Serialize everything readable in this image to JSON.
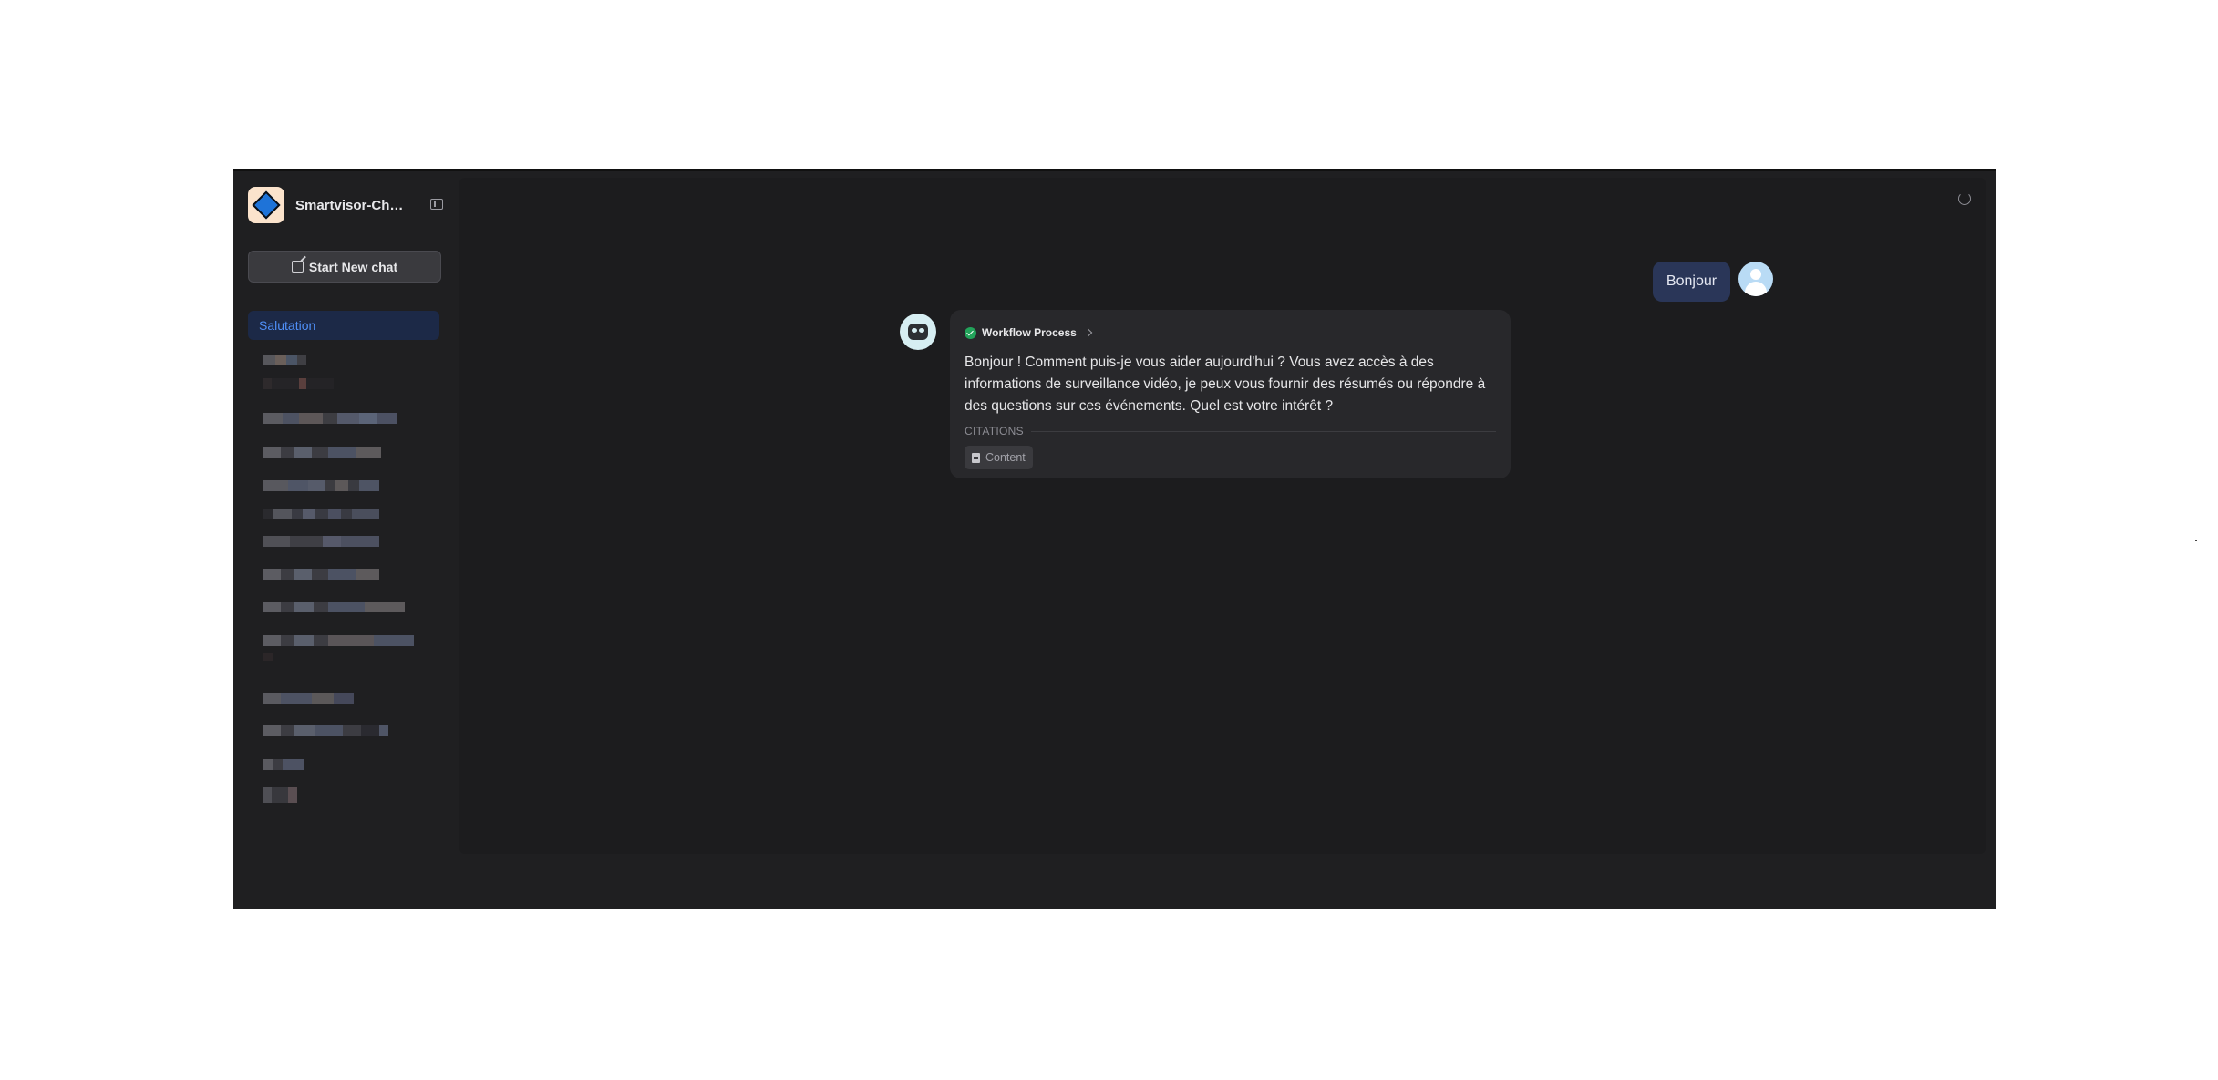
{
  "app": {
    "title": "Smartvisor-Chat..."
  },
  "sidebar": {
    "new_chat_label": "Start New chat",
    "active_conversation": "Salutation"
  },
  "conversation": {
    "user_message": "Bonjour",
    "workflow_label": "Workflow Process",
    "assistant_message": "Bonjour ! Comment puis-je vous aider aujourd'hui ? Vous avez accès à des informations de surveillance vidéo, je peux vous fournir des résumés ou répondre à des questions sur ces événements. Quel est votre intérêt ?",
    "citations_label": "CITATIONS",
    "citation_chip": "Content"
  },
  "icons": [
    "sidebar-toggle-icon",
    "edit-icon",
    "refresh-icon",
    "check-circle-icon",
    "chevron-right-icon",
    "document-icon",
    "user-avatar-icon",
    "bot-avatar-icon",
    "diamond-logo-icon"
  ],
  "colors": {
    "accent": "#4f8ff7",
    "active_bg": "#1c2947",
    "success": "#22a35a"
  }
}
